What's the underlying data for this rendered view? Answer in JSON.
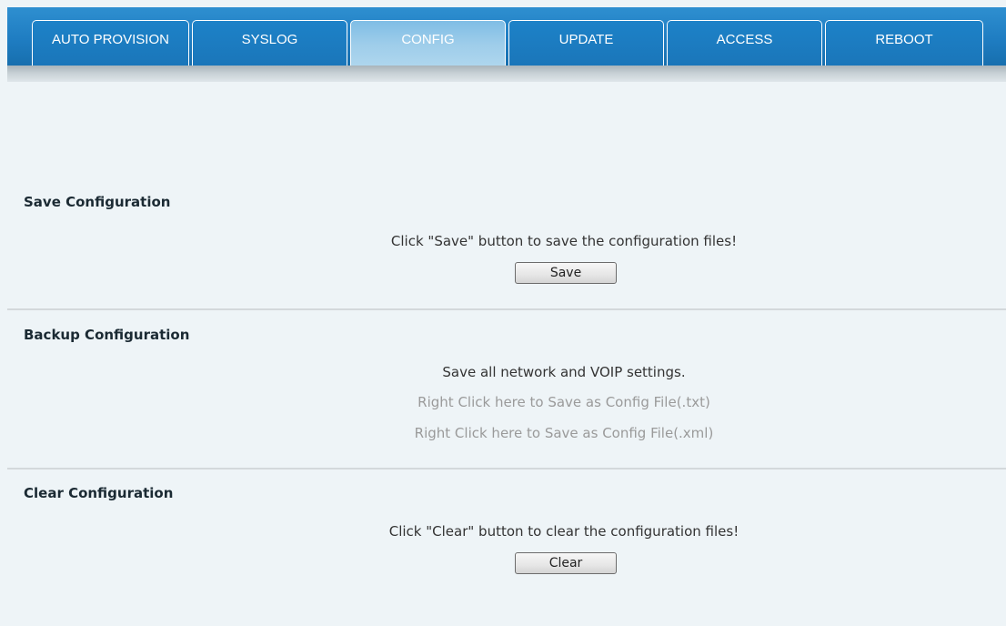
{
  "tabs": [
    {
      "label": "AUTO PROVISION",
      "active": false
    },
    {
      "label": "SYSLOG",
      "active": false
    },
    {
      "label": "CONFIG",
      "active": true
    },
    {
      "label": "UPDATE",
      "active": false
    },
    {
      "label": "ACCESS",
      "active": false
    },
    {
      "label": "REBOOT",
      "active": false
    }
  ],
  "save_section": {
    "title": "Save Configuration",
    "description": "Click \"Save\" button to save the configuration files!",
    "button_label": "Save"
  },
  "backup_section": {
    "title": "Backup Configuration",
    "description": "Save all network and VOIP settings.",
    "link_txt": "Right Click here to Save as Config File(.txt)",
    "link_xml": "Right Click here to Save as Config File(.xml)"
  },
  "clear_section": {
    "title": "Clear Configuration",
    "description": "Click \"Clear\" button to clear the configuration files!",
    "button_label": "Clear"
  },
  "colors": {
    "tab_bar": "#1f7dc2",
    "tab_active": "#9ecdea",
    "background": "#eef4f7",
    "link_gray": "#9a9a9a"
  }
}
